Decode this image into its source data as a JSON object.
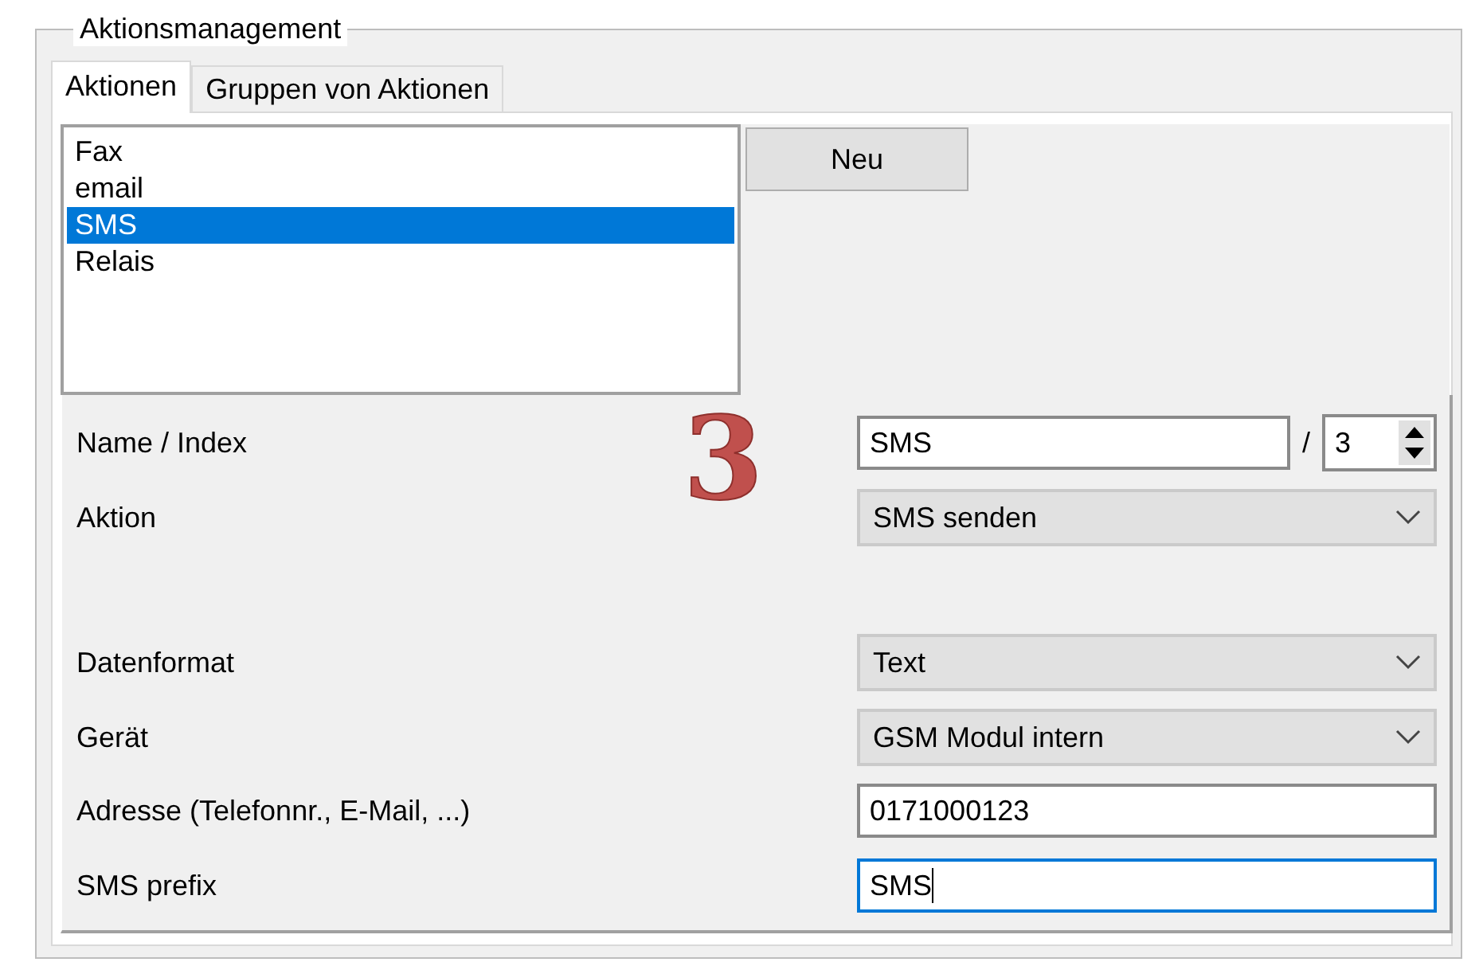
{
  "group_title": "Aktionsmanagement",
  "tabs": [
    {
      "label": "Aktionen",
      "selected": true
    },
    {
      "label": "Gruppen von Aktionen",
      "selected": false
    }
  ],
  "actions_list": [
    {
      "label": "Fax",
      "selected": false
    },
    {
      "label": "email",
      "selected": false
    },
    {
      "label": "SMS",
      "selected": true
    },
    {
      "label": "Relais",
      "selected": false
    }
  ],
  "new_button": "Neu",
  "annotation": "3",
  "form": [
    {
      "kind": "name_index",
      "label": "Name / Index",
      "value": "SMS",
      "separator": "/",
      "index": "3"
    },
    {
      "kind": "dropdown",
      "label": "Aktion",
      "value": "SMS senden"
    },
    {
      "kind": "dropdown",
      "label": "Datenformat",
      "value": "Text",
      "gap_before": true
    },
    {
      "kind": "dropdown",
      "label": "Gerät",
      "value": "GSM Modul intern"
    },
    {
      "kind": "text",
      "label": "Adresse (Telefonnr., E-Mail, ...)",
      "value": "0171000123",
      "focused": false
    },
    {
      "kind": "text",
      "label": "SMS prefix",
      "value": "SMS",
      "focused": true
    }
  ]
}
